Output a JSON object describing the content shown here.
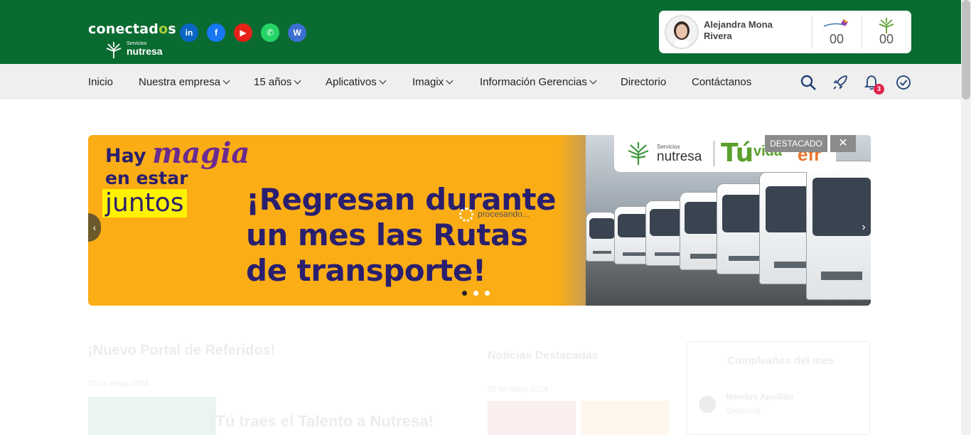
{
  "header": {
    "logo_main_prefix": "conectad",
    "logo_main_o": "o",
    "logo_main_suffix": "s",
    "logo_sub_small": "Servicios",
    "logo_sub_brand": "nutresa",
    "social": [
      {
        "name": "linkedin",
        "glyph": "in",
        "color": "#0a66c2"
      },
      {
        "name": "facebook",
        "glyph": "f",
        "color": "#1877f2"
      },
      {
        "name": "youtube",
        "glyph": "▶",
        "color": "#e62117"
      },
      {
        "name": "whatsapp",
        "glyph": "✆",
        "color": "#25d366"
      },
      {
        "name": "web",
        "glyph": "W",
        "color": "#3b6fd1"
      }
    ]
  },
  "user": {
    "name": "Alejandra Mona Rivera",
    "counter_1": "00",
    "counter_2": "00"
  },
  "nav": {
    "items": [
      {
        "label": "Inicio",
        "dropdown": false
      },
      {
        "label": "Nuestra empresa",
        "dropdown": true
      },
      {
        "label": "15 años",
        "dropdown": true
      },
      {
        "label": "Aplicativos",
        "dropdown": true
      },
      {
        "label": "Imagix",
        "dropdown": true
      },
      {
        "label": "Información Gerencias",
        "dropdown": true
      },
      {
        "label": "Directorio",
        "dropdown": false
      },
      {
        "label": "Contáctanos",
        "dropdown": false
      }
    ],
    "notification_count": "3",
    "icons": [
      "search-icon",
      "rocket-icon",
      "bell-icon",
      "check-circle-icon"
    ]
  },
  "banner": {
    "hay": "Hay",
    "magia": "magia",
    "en_estar": "en estar",
    "juntos": "juntos",
    "headline": "¡Regresan durante un mes las Rutas de transporte!",
    "logo_servicios": "Servicios",
    "logo_nutresa": "nutresa",
    "logo_tu": "Tú",
    "logo_vida": "vida",
    "logo_efr": "efr",
    "destacado_label": "DESTACADO",
    "close_label": "✕",
    "prev_label": "‹",
    "next_label": "›",
    "processing_label": "procesando...",
    "slide_count": 3,
    "active_slide": 1
  },
  "faded_content": {
    "left_title": "¡Nuevo Portal de Referidos!",
    "left_date": "20 de mayo 2024",
    "left_tagline": "¡Tú traes el Talento a Nutresa!",
    "mid_title": "Noticias Destacadas",
    "mid_date": "20 de mayo 2024",
    "right_title": "Cumpleaños del mes",
    "right_item_name": "Nombre Apellido",
    "right_item_sub": "Gerencia"
  },
  "colors": {
    "header_green": "#0a6b31",
    "banner_yellow": "#fbad16",
    "headline_purple": "#2a1f6e",
    "badge_red": "#e0224a"
  }
}
